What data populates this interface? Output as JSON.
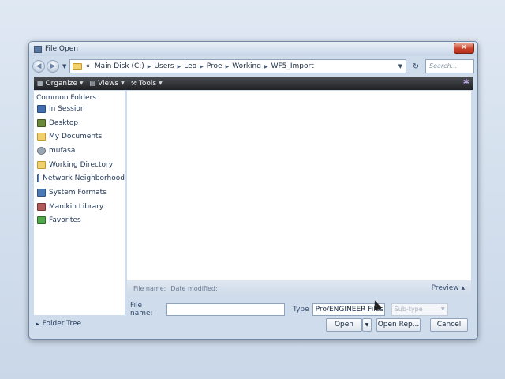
{
  "window": {
    "title": "File Open",
    "close_label": "✕"
  },
  "address": {
    "breadcrumbs": [
      "«",
      "Main Disk (C:)",
      "Users",
      "Leo",
      "Proe",
      "Working",
      "WF5_Import"
    ],
    "search_placeholder": "Search..."
  },
  "toolbar": {
    "organize": "Organize",
    "views": "Views",
    "tools": "Tools"
  },
  "sidebar": {
    "header": "Common Folders",
    "items": [
      {
        "label": "In Session",
        "icon": "session-icon"
      },
      {
        "label": "Desktop",
        "icon": "desktop-icon"
      },
      {
        "label": "My Documents",
        "icon": "documents-icon"
      },
      {
        "label": "mufasa",
        "icon": "user-icon"
      },
      {
        "label": "Working Directory",
        "icon": "folder-icon"
      },
      {
        "label": "Network Neighborhood",
        "icon": "network-icon"
      },
      {
        "label": "System Formats",
        "icon": "system-icon"
      },
      {
        "label": "Manikin Library",
        "icon": "manikin-icon"
      },
      {
        "label": "Favorites",
        "icon": "favorites-icon"
      }
    ]
  },
  "list": {
    "col_name": "File name:",
    "col_date": "Date modified:",
    "preview": "Preview ▴"
  },
  "form": {
    "filename_label": "File name:",
    "filename_value": "",
    "type_label": "Type",
    "type_value": "Pro/ENGINEER Files",
    "subtype_placeholder": "Sub-type"
  },
  "footer": {
    "folder_tree": "Folder Tree",
    "open": "Open",
    "open_rep": "Open Rep...",
    "cancel": "Cancel"
  }
}
